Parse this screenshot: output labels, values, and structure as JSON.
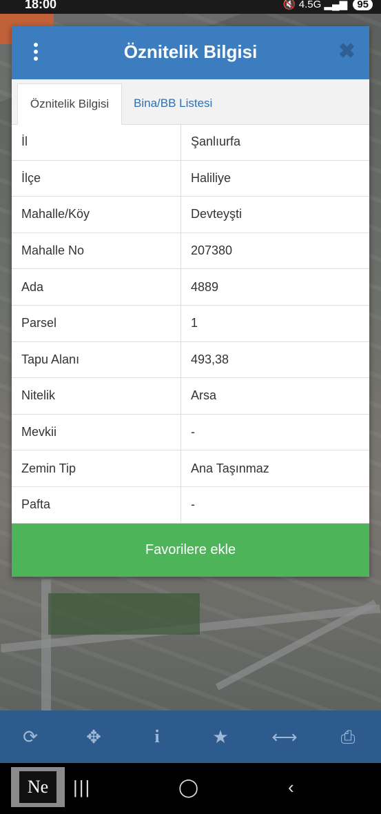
{
  "status_bar": {
    "time": "18:00",
    "network": "4.5G",
    "battery": "95"
  },
  "dialog": {
    "title": "Öznitelik Bilgisi",
    "tabs": [
      {
        "label": "Öznitelik Bilgisi",
        "active": true
      },
      {
        "label": "Bina/BB Listesi",
        "active": false
      }
    ],
    "rows": [
      {
        "key": "İl",
        "value": "Şanlıurfa"
      },
      {
        "key": "İlçe",
        "value": "Haliliye"
      },
      {
        "key": "Mahalle/Köy",
        "value": "Devteyşti"
      },
      {
        "key": "Mahalle No",
        "value": "207380"
      },
      {
        "key": "Ada",
        "value": "4889"
      },
      {
        "key": "Parsel",
        "value": "1"
      },
      {
        "key": "Tapu Alanı",
        "value": "493,38"
      },
      {
        "key": "Nitelik",
        "value": "Arsa"
      },
      {
        "key": "Mevkii",
        "value": "-"
      },
      {
        "key": "Zemin Tip",
        "value": "Ana Taşınmaz"
      },
      {
        "key": "Pafta",
        "value": "-"
      }
    ],
    "favorite_button": "Favorilere ekle"
  },
  "toolbar": {
    "icons": [
      "refresh-icon",
      "locate-icon",
      "info-icon",
      "star-icon",
      "measure-icon",
      "print-icon"
    ]
  },
  "colors": {
    "header": "#3b7dbf",
    "favorite": "#4db45a",
    "toolbar": "#2d5b8d"
  }
}
